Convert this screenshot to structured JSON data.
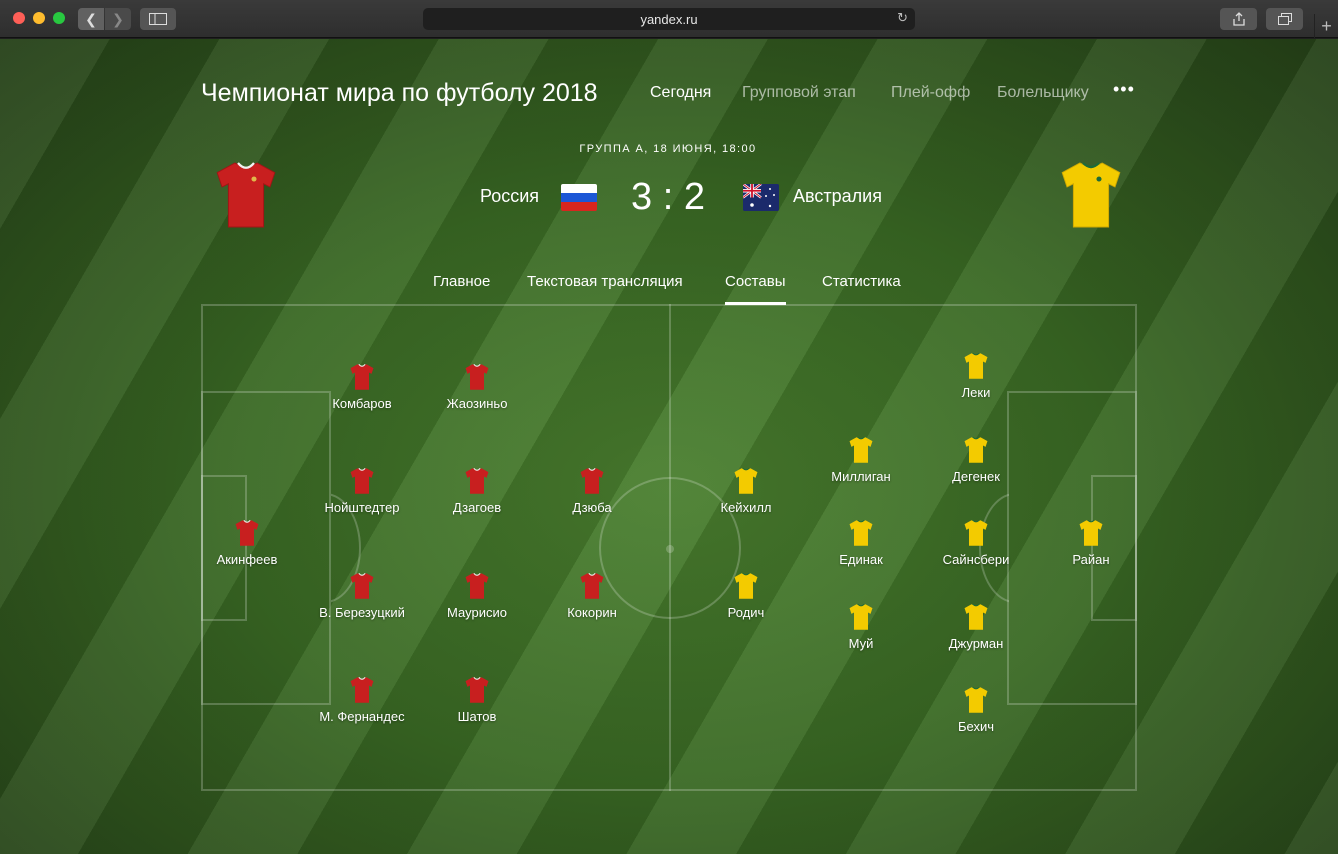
{
  "browser": {
    "url": "yandex.ru"
  },
  "header": {
    "title": "Чемпионат мира по футболу 2018",
    "nav": [
      "Сегодня",
      "Групповой этап",
      "Плей-офф",
      "Болельщику"
    ],
    "more": "•••"
  },
  "match": {
    "meta": "ГРУППА А, 18 ИЮНЯ, 18:00",
    "home_team": "Россия",
    "away_team": "Австралия",
    "score": "3 : 2",
    "home_color": "#c81f1f",
    "away_color": "#f3cb00"
  },
  "tabs": [
    "Главное",
    "Текстовая трансляция",
    "Составы",
    "Статистика"
  ],
  "active_tab": "Составы",
  "lineups": {
    "home": {
      "goalkeeper": "Акинфеев",
      "defenders": [
        "Комбаров",
        "Нойштедтер",
        "В. Березуцкий",
        "М. Фернандес"
      ],
      "midfielders": [
        "Жаозиньо",
        "Дзагоев",
        "Маурисио",
        "Шатов"
      ],
      "forwards": [
        "Дзюба",
        "Кокорин"
      ]
    },
    "away": {
      "goalkeeper": "Райан",
      "defenders": [
        "Леки",
        "Дегенек",
        "Сайнсбери",
        "Джурман",
        "Бехич"
      ],
      "midfielders": [
        "Миллиган",
        "Единак",
        "Муй"
      ],
      "forwards": [
        "Кейхилл",
        "Родич"
      ]
    }
  }
}
